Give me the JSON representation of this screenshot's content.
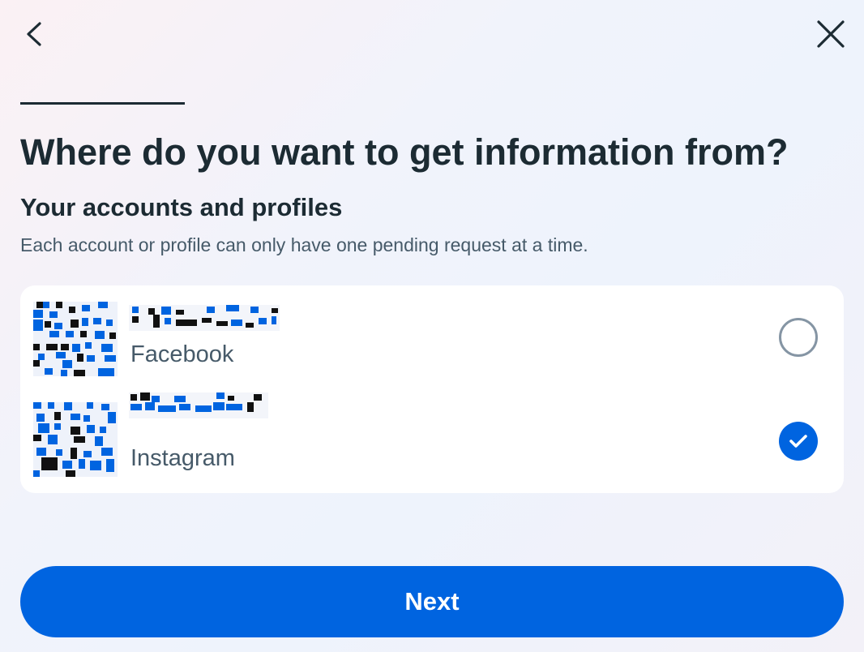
{
  "header": {
    "back_icon": "chevron-left-icon",
    "close_icon": "close-icon",
    "progress_fraction": 0.2
  },
  "title": "Where do you want to get information from?",
  "section": {
    "title": "Your accounts and profiles",
    "description": "Each account or profile can only have one pending request at a time."
  },
  "accounts": [
    {
      "platform": "Facebook",
      "selected": false
    },
    {
      "platform": "Instagram",
      "selected": true
    }
  ],
  "next_label": "Next",
  "colors": {
    "accent": "#0064e0",
    "text_primary": "#1c2b33",
    "text_secondary": "#465a69",
    "radio_border": "#8595a4"
  }
}
